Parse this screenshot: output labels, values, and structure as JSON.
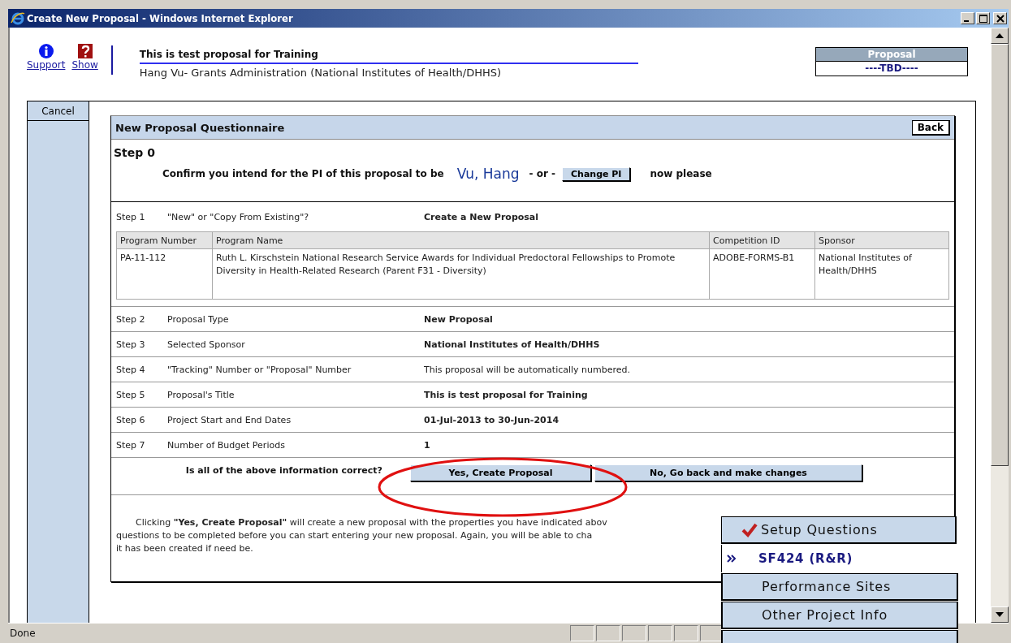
{
  "window": {
    "title": "Create New Proposal - Windows Internet Explorer"
  },
  "header": {
    "links": [
      {
        "label": "Support"
      },
      {
        "label": "Show"
      }
    ],
    "title": "This is test proposal for Training",
    "subtitle": "Hang Vu- Grants Administration (National Institutes of Health/DHHS)"
  },
  "proposal_box": {
    "heading": "Proposal",
    "value": "----TBD----"
  },
  "sidebar": {
    "cancel": "Cancel"
  },
  "questionnaire": {
    "title": "New Proposal Questionnaire",
    "back": "Back",
    "step0": {
      "heading": "Step 0",
      "prompt": "Confirm you intend for the PI of this proposal to be",
      "pi": "Vu, Hang",
      "or": "- or -",
      "change": "Change PI",
      "suffix": "now please"
    },
    "step1": {
      "step": "Step 1",
      "name": "\"New\" or \"Copy From Existing\"?",
      "value": "Create a New Proposal"
    },
    "program_table": {
      "columns": [
        "Program Number",
        "Program Name",
        "Competition ID",
        "Sponsor"
      ],
      "rows": [
        [
          "PA-11-112",
          "Ruth L. Kirschstein National Research Service Awards for Individual Predoctoral Fellowships to Promote Diversity in Health-Related Research (Parent F31 - Diversity)",
          "ADOBE-FORMS-B1",
          "National Institutes of Health/DHHS"
        ]
      ]
    },
    "steps": [
      {
        "step": "Step 2",
        "name": "Proposal Type",
        "value": "New Proposal",
        "bold": true
      },
      {
        "step": "Step 3",
        "name": "Selected Sponsor",
        "value": "National Institutes of Health/DHHS",
        "bold": true
      },
      {
        "step": "Step 4",
        "name": "\"Tracking\" Number or \"Proposal\" Number",
        "value": "This proposal will be automatically numbered.",
        "bold": false
      },
      {
        "step": "Step 5",
        "name": "Proposal's Title",
        "value": "This is test proposal for Training",
        "bold": true
      },
      {
        "step": "Step 6",
        "name": "Project Start and End Dates",
        "value": "01-Jul-2013  to  30-Jun-2014",
        "bold": true
      },
      {
        "step": "Step 7",
        "name": "Number of Budget Periods",
        "value": "1",
        "bold": true
      }
    ],
    "confirm": {
      "question": "Is all of the above information correct?",
      "buttons": [
        "Yes, Create Proposal",
        "No, Go back and make changes"
      ]
    },
    "note": [
      "Clicking **\"Yes, Create Proposal\"** will create a new proposal with the properties you have indicated abov",
      "questions to be completed before you can start entering your new proposal. Again, you will be able to cha",
      "it has been created if need be."
    ]
  },
  "menu": [
    {
      "label": "Setup Questions",
      "kind": "done"
    },
    {
      "label": "SF424 (R&R)",
      "kind": "current"
    },
    {
      "label": "Performance Sites",
      "kind": "normal"
    },
    {
      "label": "Other Project Info",
      "kind": "normal"
    },
    {
      "kind": "cut"
    }
  ],
  "status_bar": {
    "text": "Done"
  }
}
